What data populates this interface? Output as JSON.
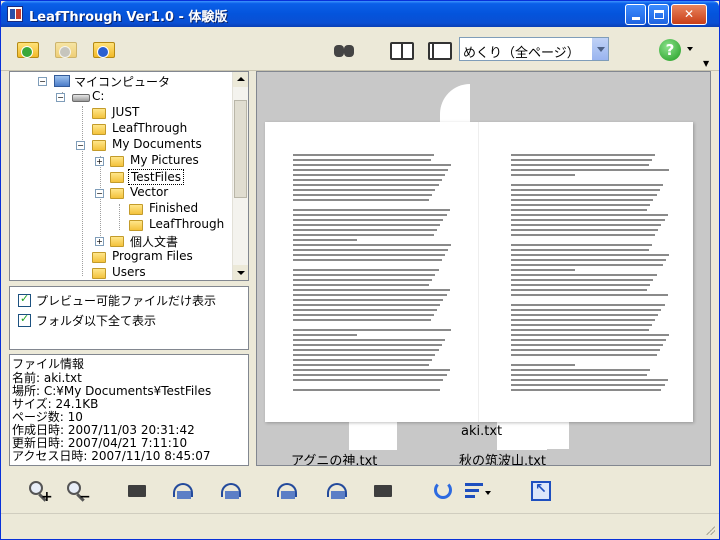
{
  "window": {
    "title": "LeafThrough Ver1.0 - 体験版"
  },
  "toolbar": {
    "icons": [
      "folder-back-icon",
      "folder-forward-icon",
      "folder-up-icon",
      "binoculars-icon",
      "book-spread-icon",
      "book-single-icon",
      "help-icon"
    ],
    "mode_select": "めくり（全ページ）"
  },
  "tree": {
    "nodes": [
      {
        "label": "マイコンピュータ"
      },
      {
        "label": "C:"
      },
      {
        "label": "JUST"
      },
      {
        "label": "LeafThrough"
      },
      {
        "label": "My Documents"
      },
      {
        "label": "My Pictures"
      },
      {
        "label": "TestFiles"
      },
      {
        "label": "Vector"
      },
      {
        "label": "Finished"
      },
      {
        "label": "LeafThrough"
      },
      {
        "label": "個人文書"
      },
      {
        "label": "Program Files"
      },
      {
        "label": "Users"
      }
    ]
  },
  "options": {
    "preview_only": {
      "label": "プレビュー可能ファイルだけ表示",
      "checked": true
    },
    "all_below_folder": {
      "label": "フォルダ以下全て表示",
      "checked": true
    }
  },
  "file_info": {
    "header": "ファイル情報",
    "lines": [
      "名前: aki.txt",
      "場所: C:¥My Documents¥TestFiles",
      "サイズ: 24.1KB",
      "ページ数: 10",
      "作成日時: 2007/11/03 20:31:42",
      "更新日時: 2007/04/21 7:11:10",
      "アクセス日時: 2007/11/10 8:45:07"
    ]
  },
  "preview": {
    "files": [
      "aki.txt",
      "アグニの神.txt",
      "秋の筑波山.txt"
    ]
  }
}
